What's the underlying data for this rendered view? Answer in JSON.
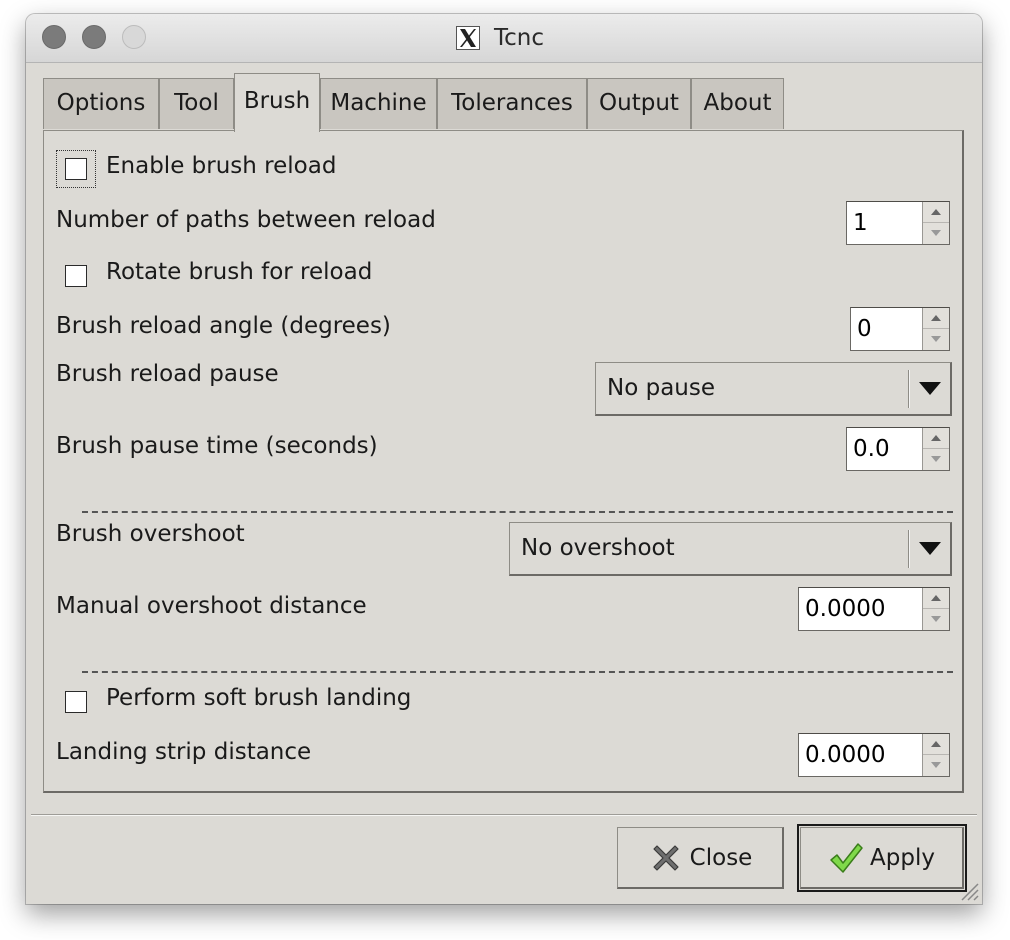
{
  "window": {
    "title": "Tcnc"
  },
  "tabs": [
    {
      "label": "Options",
      "active": false
    },
    {
      "label": "Tool",
      "active": false
    },
    {
      "label": "Brush",
      "active": true
    },
    {
      "label": "Machine",
      "active": false
    },
    {
      "label": "Tolerances",
      "active": false
    },
    {
      "label": "Output",
      "active": false
    },
    {
      "label": "About",
      "active": false
    }
  ],
  "brush": {
    "enable_reload": {
      "label": "Enable brush reload",
      "checked": false
    },
    "paths_between_reload": {
      "label": "Number of paths between reload",
      "value": "1"
    },
    "rotate_for_reload": {
      "label": "Rotate brush for reload",
      "checked": false
    },
    "reload_angle": {
      "label": "Brush reload angle (degrees)",
      "value": "0"
    },
    "reload_pause": {
      "label": "Brush reload pause",
      "selected": "No pause"
    },
    "pause_time": {
      "label": "Brush pause time (seconds)",
      "value": "0.0"
    },
    "overshoot": {
      "label": "Brush overshoot",
      "selected": "No overshoot"
    },
    "manual_overshoot": {
      "label": "Manual overshoot distance",
      "value": "0.0000"
    },
    "soft_landing": {
      "label": "Perform soft brush landing",
      "checked": false
    },
    "landing_strip": {
      "label": "Landing strip distance",
      "value": "0.0000"
    }
  },
  "buttons": {
    "close": "Close",
    "apply": "Apply"
  },
  "icons": {
    "close": "close-x-icon",
    "apply": "checkmark-icon",
    "app": "x11-icon",
    "dropdown": "triangle-down-icon"
  },
  "colors": {
    "window_bg": "#dcdad5",
    "apply_check": "#5fbf2a",
    "close_x": "#6e6e6e"
  }
}
